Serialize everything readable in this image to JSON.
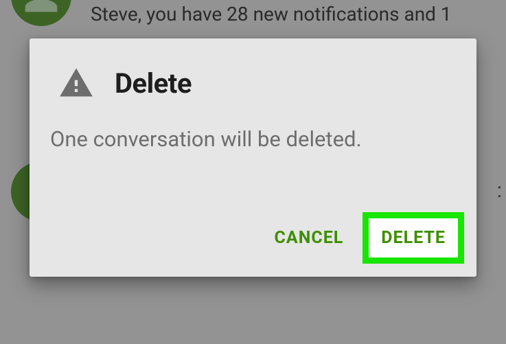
{
  "background": {
    "preview_text": "Steve, you have 28 new notifications and 1",
    "side_char": ":"
  },
  "dialog": {
    "title": "Delete",
    "message": "One conversation will be deleted.",
    "cancel_label": "CANCEL",
    "confirm_label": "DELETE"
  }
}
